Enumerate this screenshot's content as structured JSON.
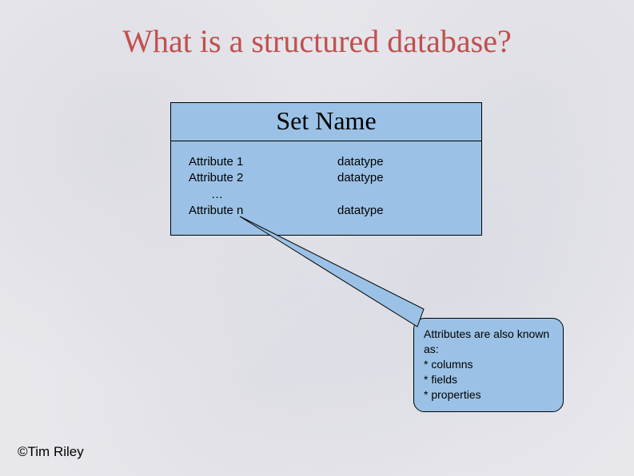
{
  "title": "What is a structured database?",
  "set": {
    "name": "Set Name",
    "rows": [
      {
        "attr": "Attribute 1",
        "type": "datatype"
      },
      {
        "attr": "Attribute 2",
        "type": "datatype"
      },
      {
        "attr": "…",
        "type": ""
      },
      {
        "attr": "Attribute n",
        "type": "datatype"
      }
    ]
  },
  "callout": {
    "heading": "Attributes are also known as:",
    "items": [
      "columns",
      "fields",
      "properties"
    ],
    "bullet": "*"
  },
  "footer": "©Tim Riley"
}
